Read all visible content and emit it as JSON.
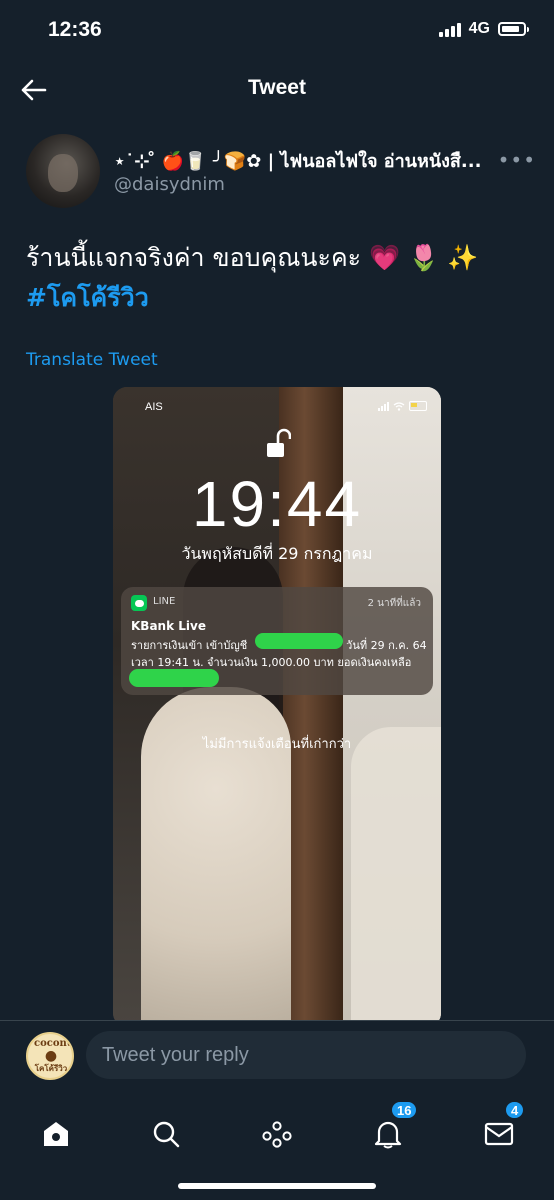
{
  "status_bar": {
    "time": "12:36",
    "network": "4G"
  },
  "header": {
    "title": "Tweet"
  },
  "tweet": {
    "display_name": "⋆˙⊹ ̊ 🍎🥛 ╯🍞✿ | ไฟนอลไฟใจ อ่านหนังสื...",
    "handle": "@daisydnim",
    "more": "•••",
    "text": "ร้านนี้แจกจริงค่า ขอบคุณนะคะ 💗 🌷 ✨",
    "hashtag": "#โคโค้รีวิว",
    "translate_label": "Translate Tweet"
  },
  "media": {
    "carrier": "AIS",
    "time": "19:44",
    "date": "วันพฤหัสบดีที่ 29 กรกฎาคม",
    "notification": {
      "app": "LINE",
      "ago": "2 นาทีที่แล้ว",
      "title": "KBank Live",
      "line1_a": "รายการเงินเข้า เข้าบัญชี",
      "line1_b": "วันที่ 29 ก.ค. 64",
      "line2": "เวลา 19:41  น. จำนวนเงิน 1,000.00  บาท ยอดเงินคงเหลือ"
    },
    "no_older": "ไม่มีการแจ้งเตือนที่เก่ากว่า"
  },
  "reply": {
    "placeholder": "Tweet your reply",
    "avatar_text_top": "coconut",
    "avatar_text_bottom": "โคโค้รีวิว"
  },
  "tabs": {
    "notifications_badge": "16",
    "messages_badge": "4"
  },
  "colors": {
    "background": "#15202b",
    "accent": "#1d9bf0",
    "muted": "#8b98a5",
    "redaction": "#2fd34a"
  }
}
